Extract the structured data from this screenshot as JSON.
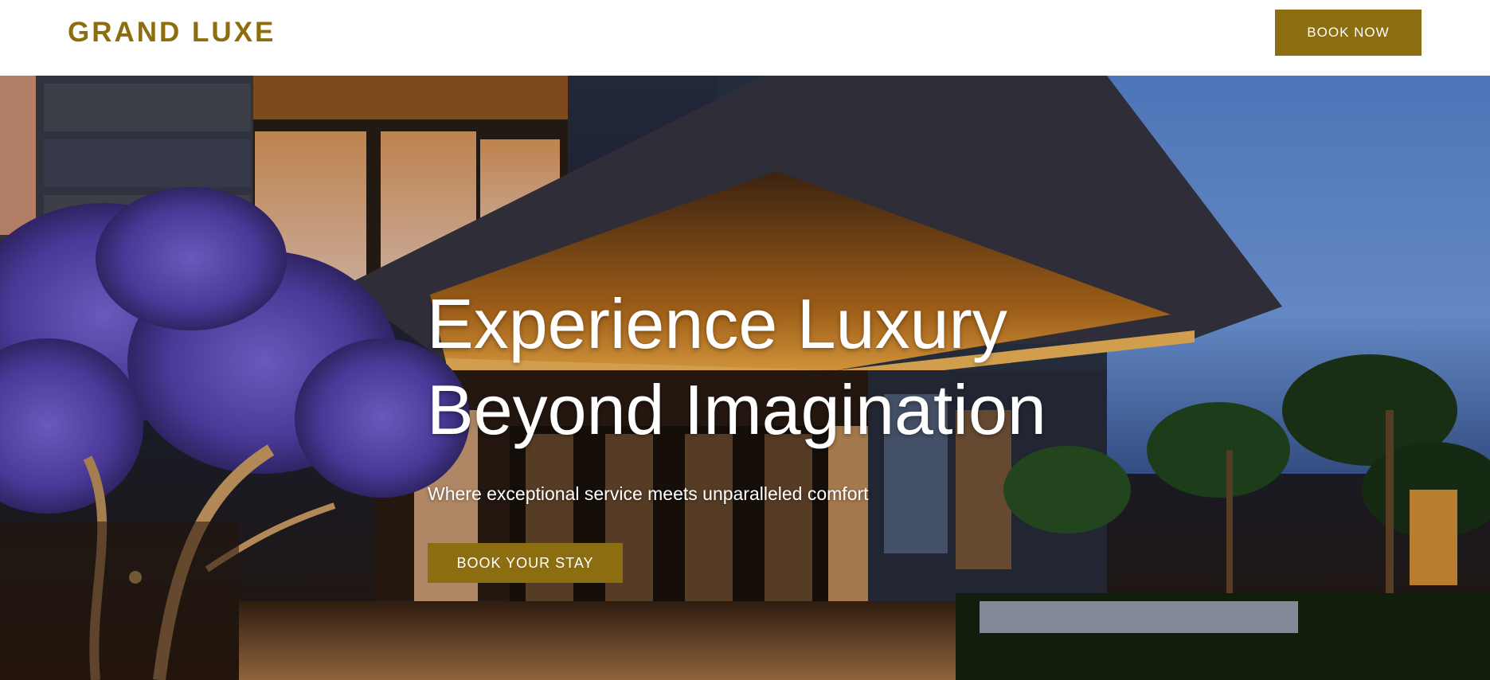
{
  "header": {
    "brand": "GRAND LUXE",
    "book_now_label": "BOOK NOW"
  },
  "hero": {
    "title_line1": "Experience Luxury",
    "title_line2": "Beyond Imagination",
    "subtitle": "Where exceptional service meets unparalleled comfort",
    "cta_label": "BOOK YOUR STAY",
    "background_image": "hotel-entrance-at-dusk"
  },
  "colors": {
    "accent": "#8c6e10",
    "header_bg": "#ffffff",
    "hero_text": "#ffffff"
  }
}
